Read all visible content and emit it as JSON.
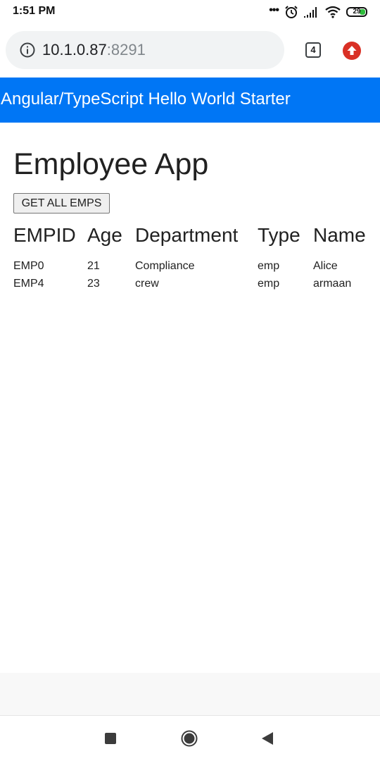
{
  "status_bar": {
    "time": "1:51 PM",
    "battery_level": "29",
    "icons": [
      "more-dots-icon",
      "alarm-icon",
      "signal-icon",
      "wifi-icon",
      "battery-icon"
    ]
  },
  "browser": {
    "url_host": "10.1.0.87",
    "url_port": ":8291",
    "tab_count": "4",
    "icons": [
      "info-icon",
      "tab-switcher-icon",
      "upload-icon"
    ]
  },
  "app_header": {
    "title": "Angular/TypeScript Hello World Starter",
    "color": "#0076f5"
  },
  "main": {
    "title": "Employee App",
    "get_button_label": "GET ALL EMPS",
    "table": {
      "headers": [
        "EMPID",
        "Age",
        "Department",
        "Type",
        "Name"
      ],
      "rows": [
        [
          "EMP0",
          "21",
          "Compliance",
          "emp",
          "Alice"
        ],
        [
          "EMP4",
          "23",
          "crew",
          "emp",
          "armaan"
        ]
      ]
    }
  },
  "nav_bar": {
    "icons": [
      "recents-square-icon",
      "home-circle-icon",
      "back-triangle-icon"
    ]
  }
}
